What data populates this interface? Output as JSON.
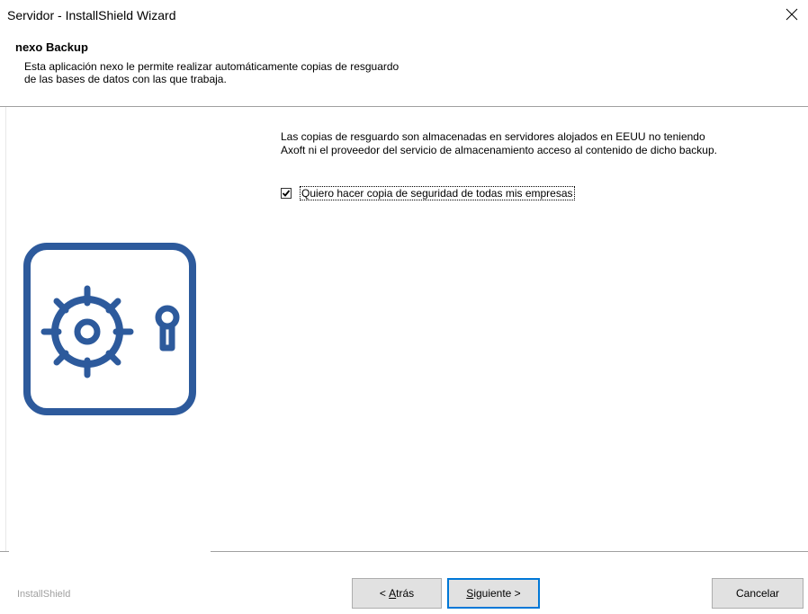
{
  "window": {
    "title": "Servidor - InstallShield Wizard",
    "close_glyph": "✕"
  },
  "header": {
    "title": "nexo Backup",
    "description_line1": "Esta aplicación nexo le permite realizar automáticamente copias de resguardo",
    "description_line2": "de las bases de datos con las que trabaja."
  },
  "main": {
    "info_line1": "Las copias de resguardo son almacenadas en servidores alojados en EEUU no teniendo",
    "info_line2": "Axoft ni el proveedor del servicio de almacenamiento acceso al contenido de dicho backup.",
    "checkbox": {
      "label": "Quiero hacer copia de seguridad de todas mis empresas",
      "checked": true
    },
    "illustration_icon": "safe-icon",
    "illustration_color": "#2d5a9c"
  },
  "footer": {
    "brand": "InstallShield",
    "back_prefix": "< ",
    "back_accel": "A",
    "back_rest": "trás",
    "next_accel": "S",
    "next_rest": "iguiente >",
    "cancel_label": "Cancelar"
  }
}
